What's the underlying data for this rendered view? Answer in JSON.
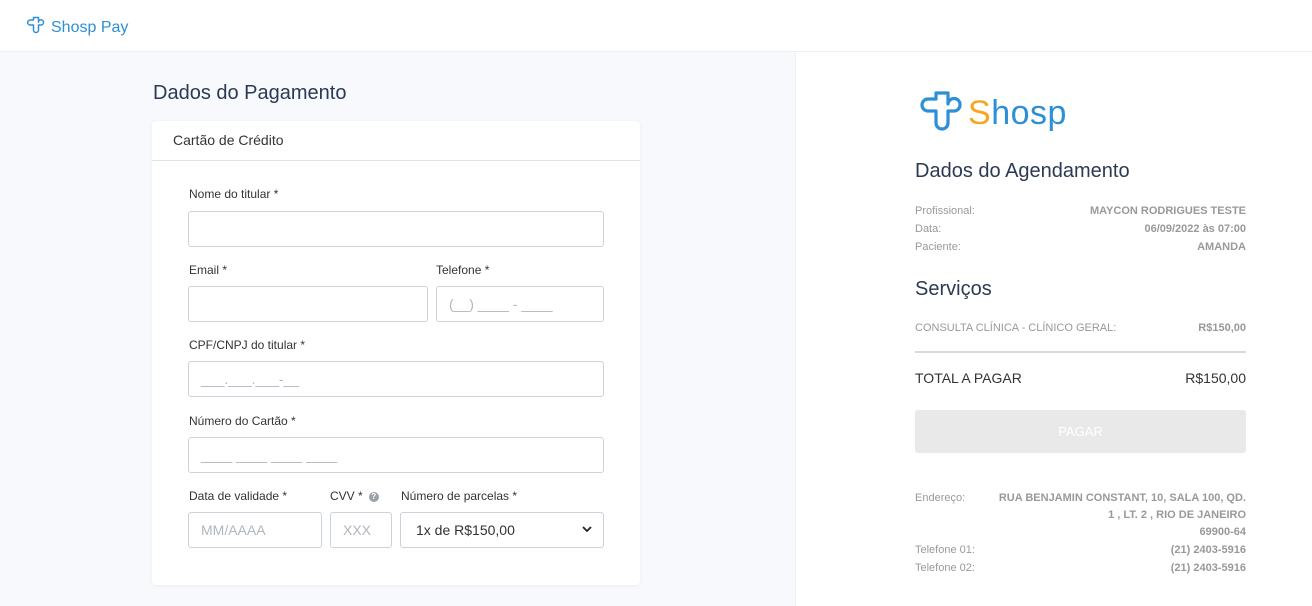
{
  "header": {
    "brand": "Shosp Pay"
  },
  "payment": {
    "title": "Dados do Pagamento",
    "card_title": "Cartão de Crédito",
    "holder_name_label": "Nome do titular *",
    "email_label": "Email *",
    "phone_label": "Telefone *",
    "phone_placeholder": "(__) ____ - ____",
    "cpf_label": "CPF/CNPJ do titular *",
    "cpf_placeholder": "___.___.___-__",
    "card_number_label": "Número do Cartão *",
    "card_number_placeholder": "____ ____ ____ ____",
    "expiry_label": "Data de validade *",
    "expiry_placeholder": "MM/AAAA",
    "cvv_label": "CVV *",
    "cvv_placeholder": "XXX",
    "installments_label": "Número de parcelas *",
    "installments_value": "1x de R$150,00"
  },
  "summary": {
    "logo_text_prefix": "S",
    "logo_text_rest": "hosp",
    "appointment_title": "Dados do Agendamento",
    "professional_label": "Profissional:",
    "professional_value": "MAYCON RODRIGUES TESTE",
    "date_label": "Data:",
    "date_value": "06/09/2022 às 07:00",
    "patient_label": "Paciente:",
    "patient_value": "AMANDA",
    "services_title": "Serviços",
    "service_name": "CONSULTA CLÍNICA - CLÍNICO GERAL:",
    "service_price": "R$150,00",
    "total_label": "TOTAL A PAGAR",
    "total_value": "R$150,00",
    "pay_button": "PAGAR",
    "address_label": "Endereço:",
    "address_line1": "RUA BENJAMIN CONSTANT, 10, SALA 100, QD.",
    "address_line2": "1 , LT. 2 , RIO DE JANEIRO",
    "address_line3": "69900-64",
    "phone1_label": "Telefone 01:",
    "phone1_value": "(21) 2403-5916",
    "phone2_label": "Telefone 02:",
    "phone2_value": "(21) 2403-5916"
  },
  "colors": {
    "brand_blue": "#2d8fd6",
    "brand_orange": "#f5a623",
    "disabled_button": "#e9e9e9"
  },
  "icons": [
    "cloud-cross-logo-icon",
    "help-circle-icon",
    "chevron-down-icon"
  ]
}
